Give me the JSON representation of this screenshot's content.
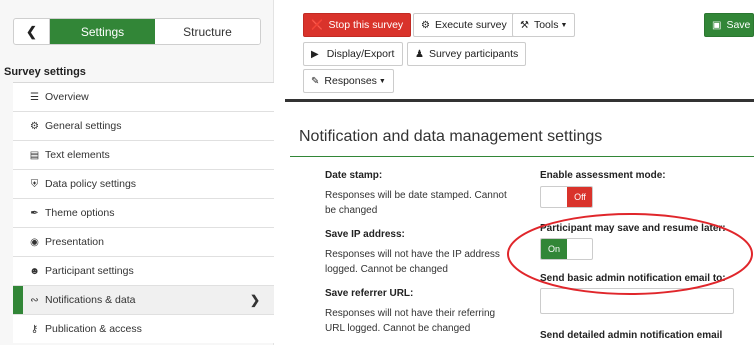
{
  "sidebar": {
    "back_icon": "chevron-left-icon",
    "tabs": [
      {
        "label": "Settings",
        "active": true
      },
      {
        "label": "Structure",
        "active": false
      }
    ],
    "heading": "Survey settings",
    "items": [
      {
        "label": "Overview",
        "icon": "list-icon",
        "active": false
      },
      {
        "label": "General settings",
        "icon": "gears-icon",
        "active": false
      },
      {
        "label": "Text elements",
        "icon": "document-icon",
        "active": false
      },
      {
        "label": "Data policy settings",
        "icon": "shield-icon",
        "active": false
      },
      {
        "label": "Theme options",
        "icon": "brush-icon",
        "active": false
      },
      {
        "label": "Presentation",
        "icon": "eye-slash-icon",
        "active": false
      },
      {
        "label": "Participant settings",
        "icon": "users-icon",
        "active": false
      },
      {
        "label": "Notifications & data",
        "icon": "rss-icon",
        "active": true
      },
      {
        "label": "Publication & access",
        "icon": "key-icon",
        "active": false
      }
    ]
  },
  "toolbar": {
    "stop_label": "Stop this survey",
    "execute_label": "Execute survey",
    "tools_label": "Tools",
    "save_label": "Save",
    "display_export_label": "Display/Export",
    "participants_label": "Survey participants",
    "responses_label": "Responses"
  },
  "main": {
    "title": "Notification and data management settings",
    "left": [
      {
        "label": "Date stamp:",
        "text": "Responses will be date stamped. Cannot be changed"
      },
      {
        "label": "Save IP address:",
        "text": "Responses will not have the IP address logged. Cannot be changed"
      },
      {
        "label": "Save referrer URL:",
        "text": "Responses will not have their referring URL logged. Cannot be changed"
      }
    ],
    "right": {
      "assessment_label": "Enable assessment mode:",
      "assessment_state": "Off",
      "resume_label": "Participant may save and resume later:",
      "resume_state": "On",
      "basic_email_label": "Send basic admin notification email to:",
      "basic_email_value": "",
      "detailed_email_label": "Send detailed admin notification email"
    }
  },
  "colors": {
    "accent": "#328637",
    "danger": "#d9332b",
    "highlight": "#e0262b"
  }
}
